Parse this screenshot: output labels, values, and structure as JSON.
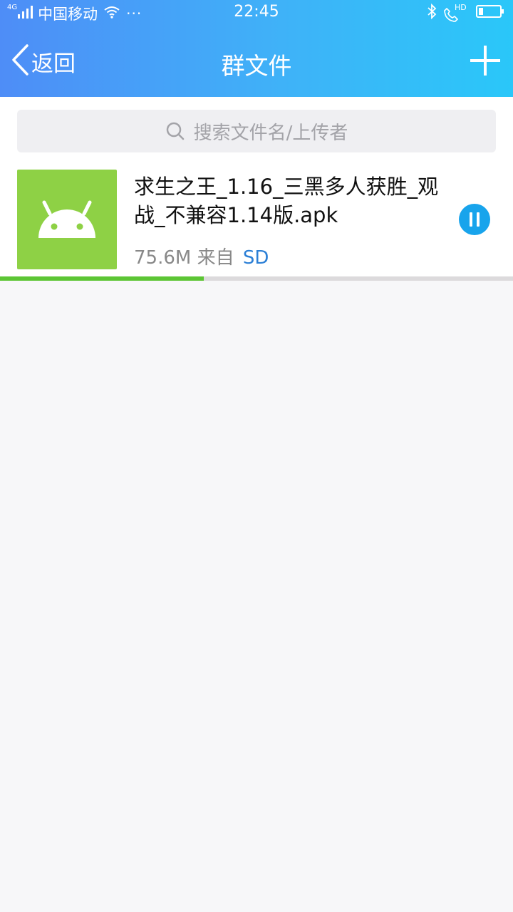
{
  "status_bar": {
    "network": "4G",
    "carrier": "中国移动",
    "more": "···",
    "time": "22:45",
    "call_badge": "HD"
  },
  "navbar": {
    "back_label": "返回",
    "title": "群文件"
  },
  "search": {
    "placeholder": "搜索文件名/上传者"
  },
  "files": [
    {
      "name": "求生之王_1.16_三黑多人获胜_观战_不兼容1.14版.apk",
      "size": "75.6M",
      "from_label": "来自",
      "uploader": "SD",
      "download_progress": 0.397,
      "state": "downloading"
    }
  ],
  "colors": {
    "header_gradient_start": "#4e8df7",
    "header_gradient_end": "#2ac7f9",
    "apk_thumb": "#8ed145",
    "progress_fill": "#5cc534",
    "pause_button": "#18a4ec",
    "uploader_link": "#2b7fd6"
  }
}
